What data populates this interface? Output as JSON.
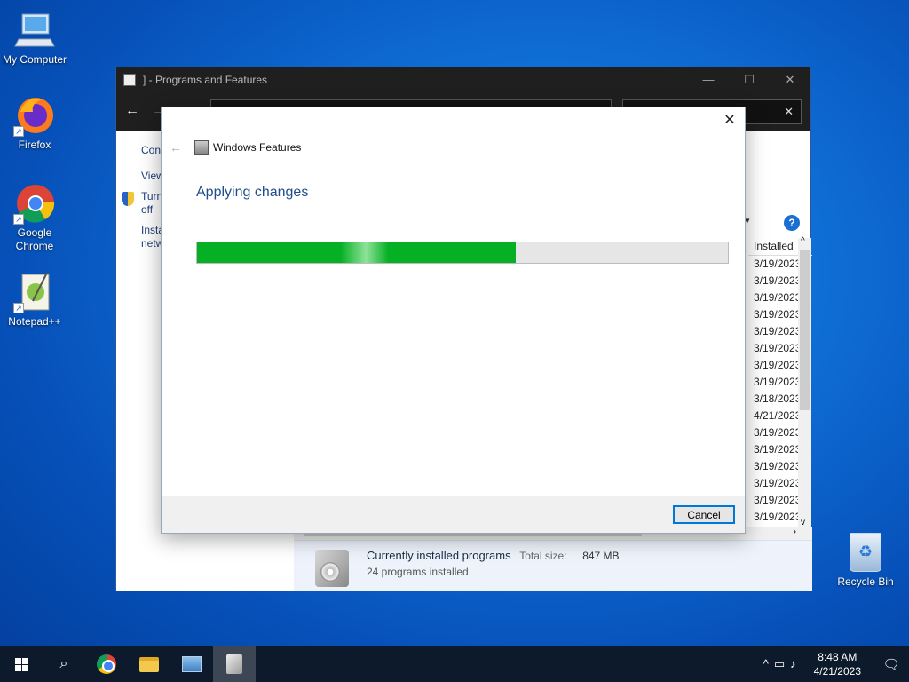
{
  "desktop": {
    "icons": [
      {
        "label": "My Computer"
      },
      {
        "label": "Firefox"
      },
      {
        "label": "Google Chrome"
      },
      {
        "label": "Notepad++"
      }
    ],
    "recycle_bin": "Recycle Bin"
  },
  "window": {
    "title": "] - Programs and Features",
    "search_clear": "✕",
    "left_pane": {
      "item1": "Con",
      "item2": "View",
      "item3_line1": "Turn",
      "item3_line2": "off",
      "item4_line1": "Insta",
      "item4_line2": "netw"
    },
    "list": {
      "column_header": "Installed",
      "dates": [
        "3/19/2023",
        "3/19/2023",
        "3/19/2023",
        "3/19/2023",
        "3/19/2023",
        "3/19/2023",
        "3/19/2023",
        "3/19/2023",
        "3/18/2023",
        "4/21/2023",
        "3/19/2023",
        "3/19/2023",
        "3/19/2023",
        "3/19/2023",
        "3/19/2023",
        "3/19/2023"
      ]
    },
    "details": {
      "title": "Currently installed programs",
      "total_size_label": "Total size:",
      "total_size_value": "847 MB",
      "count": "24 programs installed"
    }
  },
  "dialog": {
    "title": "Windows Features",
    "heading": "Applying changes",
    "progress_fraction": 0.6,
    "cancel_label": "Cancel"
  },
  "taskbar": {
    "time": "8:48 AM",
    "date": "4/21/2023"
  }
}
